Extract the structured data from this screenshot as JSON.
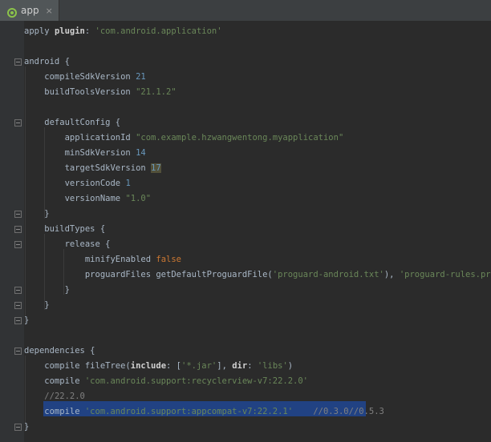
{
  "tab": {
    "label": "app",
    "close_glyph": "×",
    "icon": "android-gradle-icon"
  },
  "code_lines": [
    [
      [
        "plain",
        "apply "
      ],
      [
        "bold",
        "plugin"
      ],
      [
        "plain",
        ": "
      ],
      [
        "str",
        "'com.android.application'"
      ]
    ],
    [],
    [
      [
        "plain",
        "android {"
      ]
    ],
    [
      [
        "plain",
        "    compileSdkVersion "
      ],
      [
        "num",
        "21"
      ]
    ],
    [
      [
        "plain",
        "    buildToolsVersion "
      ],
      [
        "str",
        "\"21.1.2\""
      ]
    ],
    [],
    [
      [
        "plain",
        "    defaultConfig {"
      ]
    ],
    [
      [
        "plain",
        "        applicationId "
      ],
      [
        "str",
        "\"com.example.hzwangwentong.myapplication\""
      ]
    ],
    [
      [
        "plain",
        "        minSdkVersion "
      ],
      [
        "num",
        "14"
      ]
    ],
    [
      [
        "plain",
        "        targetSdkVersion "
      ],
      [
        "nummark",
        "17"
      ]
    ],
    [
      [
        "plain",
        "        versionCode "
      ],
      [
        "num",
        "1"
      ]
    ],
    [
      [
        "plain",
        "        versionName "
      ],
      [
        "str",
        "\"1.0\""
      ]
    ],
    [
      [
        "plain",
        "    }"
      ]
    ],
    [
      [
        "plain",
        "    buildTypes {"
      ]
    ],
    [
      [
        "plain",
        "        release {"
      ]
    ],
    [
      [
        "plain",
        "            minifyEnabled "
      ],
      [
        "kw",
        "false"
      ]
    ],
    [
      [
        "plain",
        "            proguardFiles getDefaultProguardFile("
      ],
      [
        "str",
        "'proguard-android.txt'"
      ],
      [
        "plain",
        "), "
      ],
      [
        "str",
        "'proguard-rules.pro'"
      ]
    ],
    [
      [
        "plain",
        "        }"
      ]
    ],
    [
      [
        "plain",
        "    }"
      ]
    ],
    [
      [
        "plain",
        "}"
      ]
    ],
    [],
    [
      [
        "plain",
        "dependencies {"
      ]
    ],
    [
      [
        "plain",
        "    compile fileTree("
      ],
      [
        "bold",
        "include"
      ],
      [
        "plain",
        ": ["
      ],
      [
        "str",
        "'*.jar'"
      ],
      [
        "plain",
        "], "
      ],
      [
        "bold",
        "dir"
      ],
      [
        "plain",
        ": "
      ],
      [
        "str",
        "'libs'"
      ],
      [
        "plain",
        ")"
      ]
    ],
    [
      [
        "plain",
        "    compile "
      ],
      [
        "str",
        "'com.android.support:recyclerview-v7:22.2.0'"
      ]
    ],
    [
      [
        "plain",
        "    "
      ],
      [
        "com",
        "//22.2.0"
      ]
    ],
    [
      [
        "plain",
        "    compile "
      ],
      [
        "str",
        "'com.android.support:appcompat-v7:22.2.1'"
      ],
      [
        "plain",
        "    "
      ],
      [
        "com",
        "//0.3.0//0.5.3"
      ]
    ],
    [
      [
        "plain",
        "}"
      ]
    ]
  ]
}
